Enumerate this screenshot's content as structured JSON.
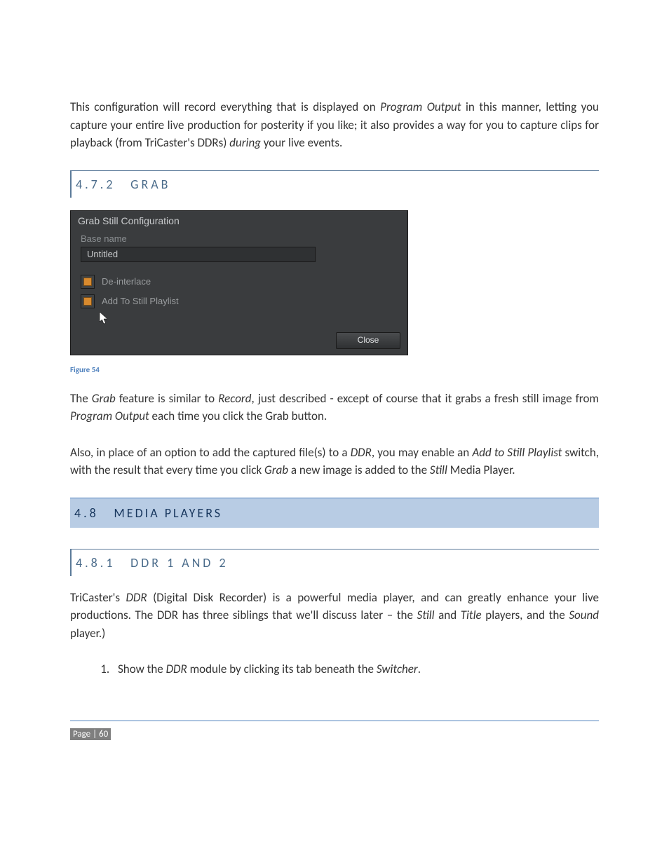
{
  "para_intro_pre": "This configuration will record everything that is displayed on ",
  "para_intro_em1": "Program Output",
  "para_intro_mid1": " in this manner, letting you capture your entire live production for posterity if you like; it also provides a way for you to capture clips for playback (from TriCaster's DDRs) ",
  "para_intro_em2": "during",
  "para_intro_post": " your live events.",
  "section_472": {
    "num": "4.7.2",
    "title": "GRAB"
  },
  "grab_panel": {
    "title": "Grab Still Configuration",
    "base_name_label": "Base name",
    "base_name_value": "Untitled",
    "deinterlace_label": "De-interlace",
    "add_to_still_label": "Add To Still Playlist",
    "close_label": "Close"
  },
  "figure_caption": "Figure 54",
  "para_grab1_pre": "The ",
  "para_grab1_em1": "Grab",
  "para_grab1_mid1": " feature is similar to ",
  "para_grab1_em2": "Record",
  "para_grab1_mid2": ", just described - except of course that it grabs a fresh still image from ",
  "para_grab1_em3": "Program Output",
  "para_grab1_post": " each time you click the Grab button.",
  "para_grab2_pre": " Also, in place of an option to add the captured file(s) to a ",
  "para_grab2_em1": "DDR",
  "para_grab2_mid1": ", you may enable an ",
  "para_grab2_em2": "Add to Still Playlist",
  "para_grab2_mid2": " switch, with the result that every time you click ",
  "para_grab2_em3": "Grab",
  "para_grab2_mid3": " a new image is added to the ",
  "para_grab2_em4": "Still",
  "para_grab2_post": " Media Player.",
  "section_48": {
    "num": "4.8",
    "title": "MEDIA PLAYERS"
  },
  "section_481": {
    "num": "4.8.1",
    "title": "DDR 1 AND 2"
  },
  "para_ddr_pre": "TriCaster's ",
  "para_ddr_em1": "DDR",
  "para_ddr_mid1": " (Digital Disk Recorder) is a powerful media player, and can greatly enhance your live productions. The DDR has three siblings that we'll discuss later – the ",
  "para_ddr_em2": "Still",
  "para_ddr_mid2": " and ",
  "para_ddr_em3": "Title",
  "para_ddr_mid3": " players, and the ",
  "para_ddr_em4": "Sound",
  "para_ddr_post": " player.)",
  "list_item1_pre": "Show the ",
  "list_item1_em1": "DDR",
  "list_item1_mid1": " module by clicking its tab beneath the ",
  "list_item1_em2": "Switcher",
  "list_item1_post": ".",
  "footer": "Page | 60"
}
